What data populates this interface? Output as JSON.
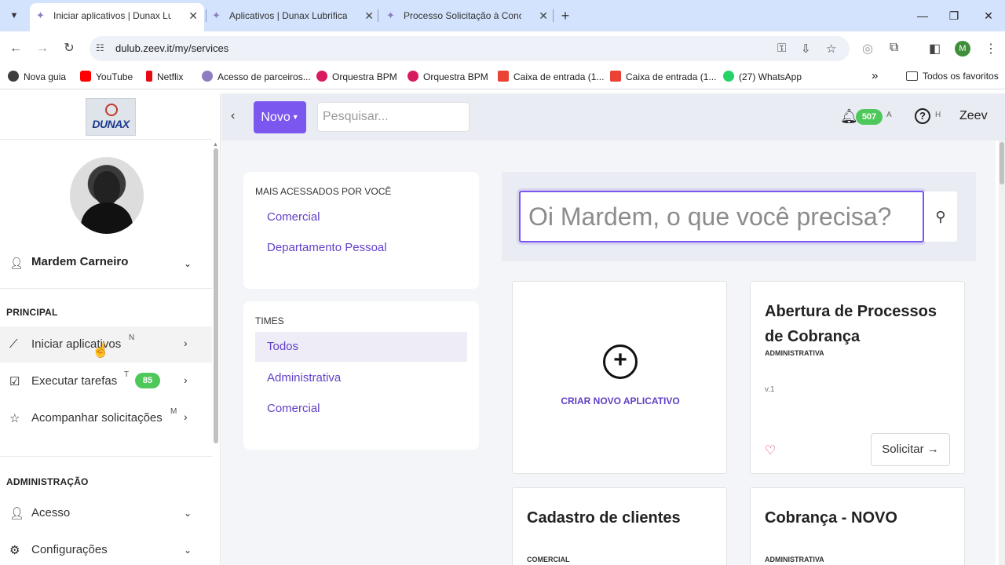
{
  "browser": {
    "tabs": [
      {
        "title": "Iniciar aplicativos | Dunax Lubrificantes",
        "close": "✕"
      },
      {
        "title": "Aplicativos | Dunax Lubrificantes",
        "close": "✕"
      },
      {
        "title": "Processo Solicitação à Conciliação",
        "close": "✕"
      }
    ],
    "new_tab": "+",
    "url": "dulub.zeev.it/my/services",
    "profile_initial": "M"
  },
  "bookmarks": [
    {
      "label": "Nova guia",
      "color": "#3d3d3d"
    },
    {
      "label": "YouTube",
      "color": "#ff0000"
    },
    {
      "label": "Netflix",
      "color": "#e50914"
    },
    {
      "label": "Acesso de parceiros...",
      "color": "#8e7cc3"
    },
    {
      "label": "Orquestra BPM",
      "color": "#d81b60"
    },
    {
      "label": "Orquestra BPM",
      "color": "#d81b60"
    },
    {
      "label": "Caixa de entrada (1...",
      "color": "#ea4335"
    },
    {
      "label": "Caixa de entrada (1...",
      "color": "#ea4335"
    },
    {
      "label": "(27) WhatsApp",
      "color": "#25d366"
    }
  ],
  "bookmarks_more": "»",
  "bookmarks_all": "Todos os favoritos",
  "sidebar": {
    "logo_text": "DUNAX",
    "user_name": "Mardem Carneiro",
    "section_principal": "PRINCIPAL",
    "section_admin": "ADMINISTRAÇÃO",
    "items": [
      {
        "label": "Iniciar aplicativos",
        "key": "N"
      },
      {
        "label": "Executar tarefas",
        "key": "T",
        "badge": "85"
      },
      {
        "label": "Acompanhar solicitações",
        "key": "M"
      }
    ],
    "admin_items": [
      {
        "label": "Acesso"
      },
      {
        "label": "Configurações"
      }
    ]
  },
  "topbar": {
    "new_label": "Novo",
    "search_placeholder": "Pesquisar...",
    "notifications": "507",
    "notifications_key": "A",
    "help_key": "H",
    "brand": "Zeev"
  },
  "most_accessed": {
    "title": "MAIS ACESSADOS POR VOCÊ",
    "items": [
      "Comercial",
      "Departamento Pessoal"
    ]
  },
  "teams": {
    "title": "TIMES",
    "items": [
      "Todos",
      "Administrativa",
      "Comercial"
    ]
  },
  "main_search": {
    "placeholder": "Oi Mardem, o que você precisa?"
  },
  "create_app": {
    "label": "CRIAR NOVO APLICATIVO"
  },
  "apps": [
    {
      "title": "Abertura de Processos de Cobrança",
      "team": "ADMINISTRATIVA",
      "version": "v.1",
      "action": "Solicitar →"
    },
    {
      "title": "Cadastro de clientes",
      "team": "COMERCIAL"
    },
    {
      "title": "Cobrança - NOVO",
      "team": "ADMINISTRATIVA"
    }
  ],
  "colors": {
    "accent": "#7b57f0",
    "badge": "#4ec85a",
    "link": "#6241c9"
  }
}
